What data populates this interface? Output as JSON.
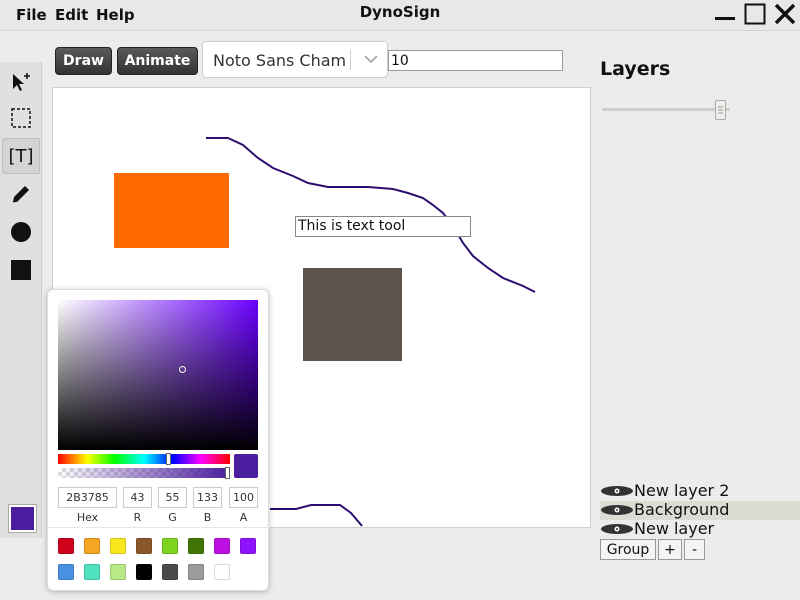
{
  "app": {
    "title": "DynoSign"
  },
  "menu": [
    {
      "label": "File"
    },
    {
      "label": "Edit"
    },
    {
      "label": "Help"
    }
  ],
  "window_controls": [
    "minimize-icon",
    "maximize-icon",
    "close-icon"
  ],
  "tools": [
    {
      "name": "select-pointer-icon"
    },
    {
      "name": "marquee-select-icon"
    },
    {
      "name": "text-tool-icon",
      "label": "[T]",
      "active": true
    },
    {
      "name": "pencil-icon"
    },
    {
      "name": "circle-shape-icon"
    },
    {
      "name": "rectangle-shape-icon"
    }
  ],
  "current_color": "#4a1e9e",
  "top_controls": {
    "draw_label": "Draw",
    "animate_label": "Animate",
    "font_family": "Noto Sans Cham",
    "size_value": "10"
  },
  "canvas": {
    "text_box_value": "This is text tool",
    "shapes": [
      {
        "kind": "rectangle",
        "color": "#ff6a00"
      },
      {
        "kind": "rectangle",
        "color": "#5e544c"
      }
    ],
    "stroke_color": "#2e0e6e"
  },
  "color_picker": {
    "hex": "2B3785",
    "r": "43",
    "g": "55",
    "b": "133",
    "a": "100",
    "hex_label": "Hex",
    "r_label": "R",
    "g_label": "G",
    "b_label": "B",
    "a_label": "A",
    "preview_color": "#4a1e9e",
    "presets": [
      "#d0021b",
      "#f5a623",
      "#f8e71c",
      "#8b572a",
      "#7ed321",
      "#417505",
      "#bd10e0",
      "#9013fe",
      "#4a90e2",
      "#50e3c2",
      "#b8e986",
      "#000000",
      "#4a4a4a",
      "#9b9b9b",
      "#ffffff"
    ]
  },
  "layers": {
    "title": "Layers",
    "opacity_percent": 97,
    "items": [
      {
        "name": "New layer 2",
        "selected": false
      },
      {
        "name": "Background",
        "selected": true
      },
      {
        "name": "New layer",
        "selected": false
      }
    ],
    "group_label": "Group",
    "add_label": "+",
    "remove_label": "-"
  }
}
